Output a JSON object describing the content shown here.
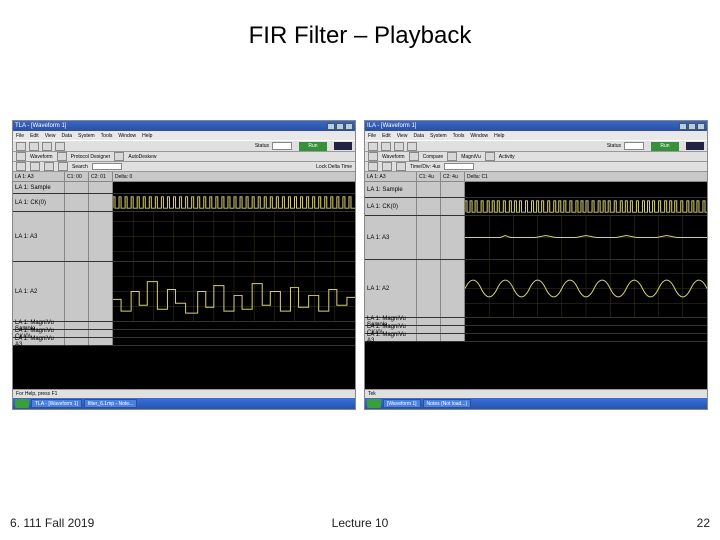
{
  "title": "FIR Filter – Playback",
  "footer": {
    "left": "6. 111 Fall 2019",
    "center": "Lecture 10",
    "right": "22"
  },
  "left_window": {
    "title": "TLA - [Waveform 1]",
    "menus": [
      "File",
      "Edit",
      "View",
      "Data",
      "System",
      "Tools",
      "Window",
      "Help"
    ],
    "run_label": "Run",
    "toolbar2": [
      "Waveform",
      "Protocol Designer",
      "AutoDeskew"
    ],
    "search_label": "Search",
    "header_cols": [
      "LA 1: A3",
      "C1: 00",
      "C2: 01",
      "Delta: 0"
    ],
    "signals": [
      {
        "name": "LA 1: Sample"
      },
      {
        "name": "LA 1: CK(0)"
      },
      {
        "name": "LA 1: A3"
      },
      {
        "name": "LA 1: A2"
      }
    ],
    "magnify": [
      {
        "name": "LA 1: MagniVu Sample"
      },
      {
        "name": "LA 1: MagniVu CK(0)"
      },
      {
        "name": "LA 1: MagniVu A3"
      }
    ],
    "status": "For Help, press F1",
    "taskbar": [
      "TLA - [Waveform 1]",
      "filter_6.1mp - Note..."
    ]
  },
  "right_window": {
    "title": "ILA - [Waveform 1]",
    "menus": [
      "File",
      "Edit",
      "View",
      "Data",
      "System",
      "Tools",
      "Window",
      "Help"
    ],
    "run_label": "Run",
    "toolbar2": [
      "Waveform",
      "Compare",
      "MagniVu",
      "Activity"
    ],
    "time_label": "Time/Div: 4us",
    "header_cols": [
      "LA 1: A3",
      "C1: 4u",
      "C2: 4u",
      "Delta: C1"
    ],
    "signals": [
      {
        "name": "LA 1: Sample"
      },
      {
        "name": "LA 1: CK(0)"
      },
      {
        "name": "LA 1: A3"
      },
      {
        "name": "LA 1: A2"
      }
    ],
    "magnify": [
      {
        "name": "LA 1: MagniVu Sample"
      },
      {
        "name": "LA 1: MagniVu CK(0)"
      },
      {
        "name": "LA 1: MagniVu A3"
      }
    ],
    "status": "Tek",
    "taskbar": [
      "[Waveform 1]",
      "Notes (Not load...)"
    ]
  }
}
